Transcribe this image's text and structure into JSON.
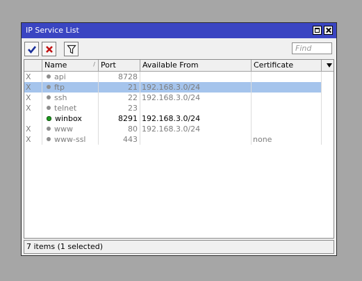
{
  "window": {
    "title": "IP Service List"
  },
  "toolbar": {
    "enable_icon": "check-icon",
    "disable_icon": "x-icon",
    "filter_icon": "filter-icon",
    "find_placeholder": "Find"
  },
  "table": {
    "columns": [
      "Name",
      "Port",
      "Available From",
      "Certificate"
    ],
    "rows": [
      {
        "flag": "X",
        "name": "api",
        "port": "8728",
        "from": "",
        "cert": ""
      },
      {
        "flag": "X",
        "name": "ftp",
        "port": "21",
        "from": "192.168.3.0/24",
        "cert": ""
      },
      {
        "flag": "X",
        "name": "ssh",
        "port": "22",
        "from": "192.168.3.0/24",
        "cert": ""
      },
      {
        "flag": "X",
        "name": "telnet",
        "port": "23",
        "from": "",
        "cert": ""
      },
      {
        "flag": "",
        "name": "winbox",
        "port": "8291",
        "from": "192.168.3.0/24",
        "cert": ""
      },
      {
        "flag": "X",
        "name": "www",
        "port": "80",
        "from": "192.168.3.0/24",
        "cert": ""
      },
      {
        "flag": "X",
        "name": "www-ssl",
        "port": "443",
        "from": "",
        "cert": "none"
      }
    ]
  },
  "status": {
    "text": "7 items (1 selected)"
  },
  "colors": {
    "titlebar": "#3a45c2",
    "selected_row": "#a5c4ec",
    "enabled_dot": "#1e9a1e"
  }
}
